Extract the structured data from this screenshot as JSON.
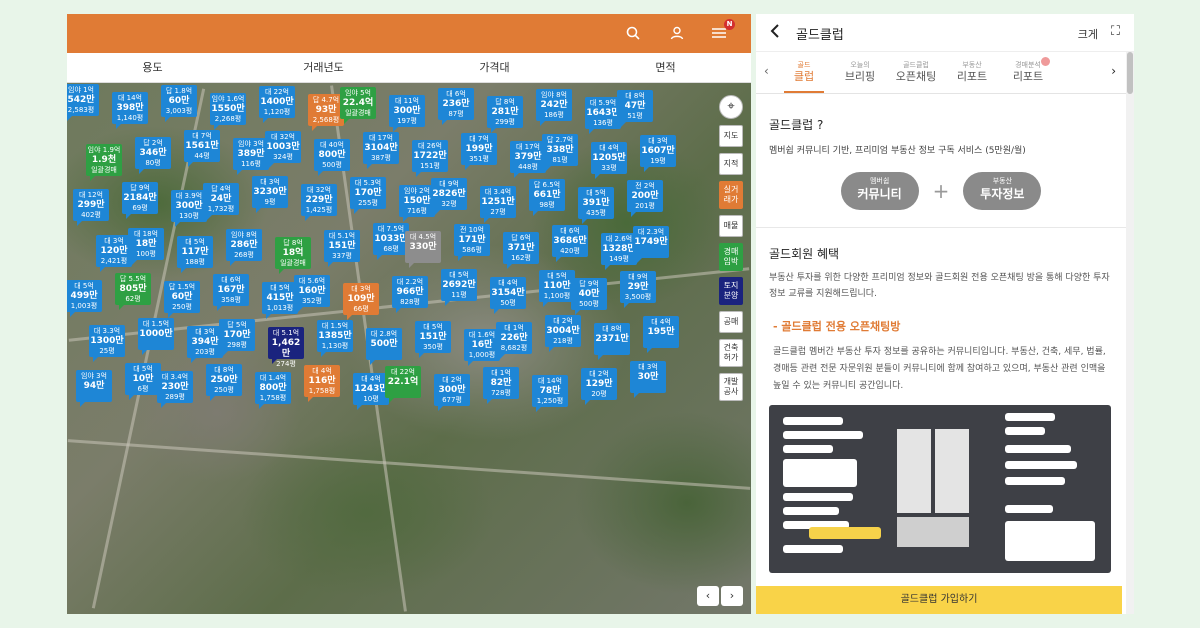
{
  "filters": [
    "용도",
    "거래년도",
    "가격대",
    "면적"
  ],
  "topbar": {
    "badge": "N"
  },
  "map_controls": [
    {
      "label": "지도"
    },
    {
      "label": "지적"
    },
    {
      "label": "실거래가",
      "style": "orange"
    },
    {
      "label": "매물"
    },
    {
      "label": "경매임박",
      "style": "green"
    },
    {
      "label": "토지분양",
      "style": "navy"
    },
    {
      "label": "공매"
    },
    {
      "label": "건축허가"
    },
    {
      "label": "개발공사"
    }
  ],
  "markers": [
    {
      "top": "임야 1억",
      "val": "542만",
      "bot": "2,583평",
      "c": ""
    },
    {
      "top": "대 14억",
      "val": "398만",
      "bot": "1,140평",
      "c": ""
    },
    {
      "top": "답 1.8억",
      "val": "60만",
      "bot": "3,003평",
      "c": ""
    },
    {
      "top": "임야 1.6억",
      "val": "1550만",
      "bot": "2,268평",
      "c": ""
    },
    {
      "top": "대 22억",
      "val": "1400만",
      "bot": "1,120평",
      "c": ""
    },
    {
      "top": "답 4.7억",
      "val": "93만",
      "bot": "2,568평",
      "c": "o"
    },
    {
      "top": "임야 5억",
      "val": "22.4억",
      "bot": "일괄경매",
      "c": "g"
    },
    {
      "top": "대 11억",
      "val": "300만",
      "bot": "197평",
      "c": ""
    },
    {
      "top": "대 6억",
      "val": "236만",
      "bot": "87평",
      "c": ""
    },
    {
      "top": "답 8억",
      "val": "281만",
      "bot": "299평",
      "c": ""
    },
    {
      "top": "임야 8억",
      "val": "242만",
      "bot": "186평",
      "c": ""
    },
    {
      "top": "대 5.9억",
      "val": "1643만",
      "bot": "136평",
      "c": ""
    },
    {
      "top": "대 8억",
      "val": "47만",
      "bot": "51평",
      "c": ""
    },
    {
      "top": "임야 1.9억",
      "val": "1.9천",
      "bot": "일괄경매",
      "c": "g"
    },
    {
      "top": "답 2억",
      "val": "346만",
      "bot": "80평",
      "c": ""
    },
    {
      "top": "대 7억",
      "val": "1561만",
      "bot": "44평",
      "c": ""
    },
    {
      "top": "임야 3억",
      "val": "389만",
      "bot": "116평",
      "c": ""
    },
    {
      "top": "대 32억",
      "val": "1003만",
      "bot": "324평",
      "c": ""
    },
    {
      "top": "대 40억",
      "val": "800만",
      "bot": "500평",
      "c": ""
    },
    {
      "top": "대 17억",
      "val": "3104만",
      "bot": "387평",
      "c": ""
    },
    {
      "top": "대 26억",
      "val": "1722만",
      "bot": "151평",
      "c": ""
    },
    {
      "top": "대 7억",
      "val": "199만",
      "bot": "351평",
      "c": ""
    },
    {
      "top": "대 17억",
      "val": "379만",
      "bot": "448평",
      "c": ""
    },
    {
      "top": "답 2.7억",
      "val": "338만",
      "bot": "81평",
      "c": ""
    },
    {
      "top": "대 4억",
      "val": "1205만",
      "bot": "33평",
      "c": ""
    },
    {
      "top": "대 3억",
      "val": "1607만",
      "bot": "19평",
      "c": ""
    },
    {
      "top": "대 12억",
      "val": "299만",
      "bot": "402평",
      "c": ""
    },
    {
      "top": "답 9억",
      "val": "2184만",
      "bot": "69평",
      "c": ""
    },
    {
      "top": "대 3.9억",
      "val": "300만",
      "bot": "130평",
      "c": ""
    },
    {
      "top": "답 4억",
      "val": "24만",
      "bot": "1,732평",
      "c": ""
    },
    {
      "top": "대 3억",
      "val": "3230만",
      "bot": "9평",
      "c": ""
    },
    {
      "top": "대 32억",
      "val": "229만",
      "bot": "1,425평",
      "c": ""
    },
    {
      "top": "대 5.3억",
      "val": "170만",
      "bot": "255평",
      "c": ""
    },
    {
      "top": "임야 2억",
      "val": "150만",
      "bot": "716평",
      "c": ""
    },
    {
      "top": "대 9억",
      "val": "2826만",
      "bot": "32평",
      "c": ""
    },
    {
      "top": "대 3.4억",
      "val": "1251만",
      "bot": "27평",
      "c": ""
    },
    {
      "top": "답 6.5억",
      "val": "661만",
      "bot": "98평",
      "c": ""
    },
    {
      "top": "대 5억",
      "val": "391만",
      "bot": "435평",
      "c": ""
    },
    {
      "top": "전 2억",
      "val": "200만",
      "bot": "201평",
      "c": ""
    },
    {
      "top": "대 3억",
      "val": "120만",
      "bot": "2,421평",
      "c": ""
    },
    {
      "top": "대 18억",
      "val": "18만",
      "bot": "100평",
      "c": ""
    },
    {
      "top": "대 5억",
      "val": "117만",
      "bot": "188평",
      "c": ""
    },
    {
      "top": "임야 8억",
      "val": "286만",
      "bot": "268평",
      "c": ""
    },
    {
      "top": "답 8억",
      "val": "18억",
      "bot": "일괄경매",
      "c": "g"
    },
    {
      "top": "대 5.1억",
      "val": "151만",
      "bot": "337평",
      "c": ""
    },
    {
      "top": "대 7.5억",
      "val": "1033만",
      "bot": "68평",
      "c": ""
    },
    {
      "top": "대 4.5억",
      "val": "330만",
      "bot": "",
      "c": "gr"
    },
    {
      "top": "전 10억",
      "val": "171만",
      "bot": "586평",
      "c": ""
    },
    {
      "top": "답 6억",
      "val": "371만",
      "bot": "162평",
      "c": ""
    },
    {
      "top": "대 6억",
      "val": "3686만",
      "bot": "420평",
      "c": ""
    },
    {
      "top": "대 2.6억",
      "val": "1328만",
      "bot": "149평",
      "c": ""
    },
    {
      "top": "대 2.3억",
      "val": "1749만",
      "bot": "",
      "c": ""
    },
    {
      "top": "대 5억",
      "val": "499만",
      "bot": "1,003평",
      "c": ""
    },
    {
      "top": "답 5.5억",
      "val": "805만",
      "bot": "62평",
      "c": "g"
    },
    {
      "top": "답 1.5억",
      "val": "60만",
      "bot": "250평",
      "c": ""
    },
    {
      "top": "대 6억",
      "val": "167만",
      "bot": "358평",
      "c": ""
    },
    {
      "top": "대 5억",
      "val": "415만",
      "bot": "1,013평",
      "c": ""
    },
    {
      "top": "대 5.6억",
      "val": "160만",
      "bot": "352평",
      "c": ""
    },
    {
      "top": "대 3억",
      "val": "109만",
      "bot": "66평",
      "c": "o"
    },
    {
      "top": "대 2.2억",
      "val": "966만",
      "bot": "828평",
      "c": ""
    },
    {
      "top": "대 5억",
      "val": "2692만",
      "bot": "11평",
      "c": ""
    },
    {
      "top": "대 4억",
      "val": "3154만",
      "bot": "50평",
      "c": ""
    },
    {
      "top": "대 5억",
      "val": "110만",
      "bot": "1,100평",
      "c": ""
    },
    {
      "top": "답 9억",
      "val": "40만",
      "bot": "500평",
      "c": ""
    },
    {
      "top": "대 9억",
      "val": "29만",
      "bot": "3,500평",
      "c": ""
    },
    {
      "top": "대 3.3억",
      "val": "1300만",
      "bot": "25평",
      "c": ""
    },
    {
      "top": "대 1.5억",
      "val": "1000만",
      "bot": "",
      "c": ""
    },
    {
      "top": "대 3억",
      "val": "394만",
      "bot": "203평",
      "c": ""
    },
    {
      "top": "답 5억",
      "val": "170만",
      "bot": "298평",
      "c": ""
    },
    {
      "top": "대 5.1억",
      "val": "1,462만",
      "bot": "274평",
      "c": "n"
    },
    {
      "top": "대 1.5억",
      "val": "1385만",
      "bot": "1,130평",
      "c": ""
    },
    {
      "top": "대 2.8억",
      "val": "500만",
      "bot": "",
      "c": ""
    },
    {
      "top": "대 5억",
      "val": "151만",
      "bot": "350평",
      "c": ""
    },
    {
      "top": "대 1.6억",
      "val": "16만",
      "bot": "1,000평",
      "c": ""
    },
    {
      "top": "대 1억",
      "val": "226만",
      "bot": "8,682평",
      "c": ""
    },
    {
      "top": "대 2억",
      "val": "3004만",
      "bot": "218평",
      "c": ""
    },
    {
      "top": "대 8억",
      "val": "2371만",
      "bot": "",
      "c": ""
    },
    {
      "top": "대 4억",
      "val": "195만",
      "bot": "",
      "c": ""
    },
    {
      "top": "임야 3억",
      "val": "94만",
      "bot": "",
      "c": ""
    },
    {
      "top": "대 5억",
      "val": "10만",
      "bot": "6평",
      "c": ""
    },
    {
      "top": "대 3.4억",
      "val": "230만",
      "bot": "289평",
      "c": ""
    },
    {
      "top": "대 8억",
      "val": "250만",
      "bot": "250평",
      "c": ""
    },
    {
      "top": "대 1.4억",
      "val": "800만",
      "bot": "1,758평",
      "c": ""
    },
    {
      "top": "대 4억",
      "val": "116만",
      "bot": "1,758평",
      "c": "o"
    },
    {
      "top": "대 4억",
      "val": "1243만",
      "bot": "10평",
      "c": ""
    },
    {
      "top": "대 22억",
      "val": "22.1억",
      "bot": "",
      "c": "g"
    },
    {
      "top": "대 2억",
      "val": "300만",
      "bot": "677평",
      "c": ""
    },
    {
      "top": "대 1억",
      "val": "82만",
      "bot": "728평",
      "c": ""
    },
    {
      "top": "대 14억",
      "val": "78만",
      "bot": "1,250평",
      "c": ""
    },
    {
      "top": "대 2억",
      "val": "129만",
      "bot": "20평",
      "c": ""
    },
    {
      "top": "대 3억",
      "val": "30만",
      "bot": "",
      "c": ""
    }
  ],
  "panel": {
    "title": "골드클럽",
    "size_label": "크게",
    "tabs": [
      {
        "small": "골드",
        "main": "클럽",
        "active": true
      },
      {
        "small": "오늘의",
        "main": "브리핑"
      },
      {
        "small": "골드클럽",
        "main": "오픈채팅"
      },
      {
        "small": "부동산",
        "main": "리포트"
      },
      {
        "small": "경매분석",
        "main": "리포트",
        "dot": true
      }
    ],
    "q_title": "골드클럽 ?",
    "q_desc": "멤버쉽 커뮤니티 기반, 프리미엄 부동산 정보 구독 서비스 (5만원/월)",
    "pill1_small": "멤버쉽",
    "pill1_main": "커뮤니티",
    "plus": "+",
    "pill2_small": "부동산",
    "pill2_main": "투자정보",
    "benefit_title": "골드회원 혜택",
    "benefit_text": "부동산 투자를 위한 다양한 프리미엄 정보와 골드회원 전용 오픈채팅 방을 통해 다양한 투자 정보 교류를 지원해드립니다.",
    "chat_title": "- 골드클럽 전용 오픈채팅방",
    "chat_text": "골드클럽 멤버간 부동산 투자 정보를 공유하는 커뮤니티입니다. 부동산, 건축, 세무, 법률, 경매등 관련 전문 자문위원 분들이 커뮤니티에 함께 참여하고 있으며, 부동산 관련 인맥을 높일 수 있는 커뮤니티 공간입니다.",
    "join": "골드클럽 가입하기"
  },
  "icons": {
    "search": "search-icon",
    "user": "user-icon",
    "menu": "menu-icon",
    "back": "chevron-left-icon",
    "expand": "expand-icon",
    "locate": "crosshair-icon"
  },
  "colors": {
    "brand": "#e07b35",
    "marker": "#1e86d6",
    "auction": "#2ea043",
    "join": "#f9d348"
  }
}
